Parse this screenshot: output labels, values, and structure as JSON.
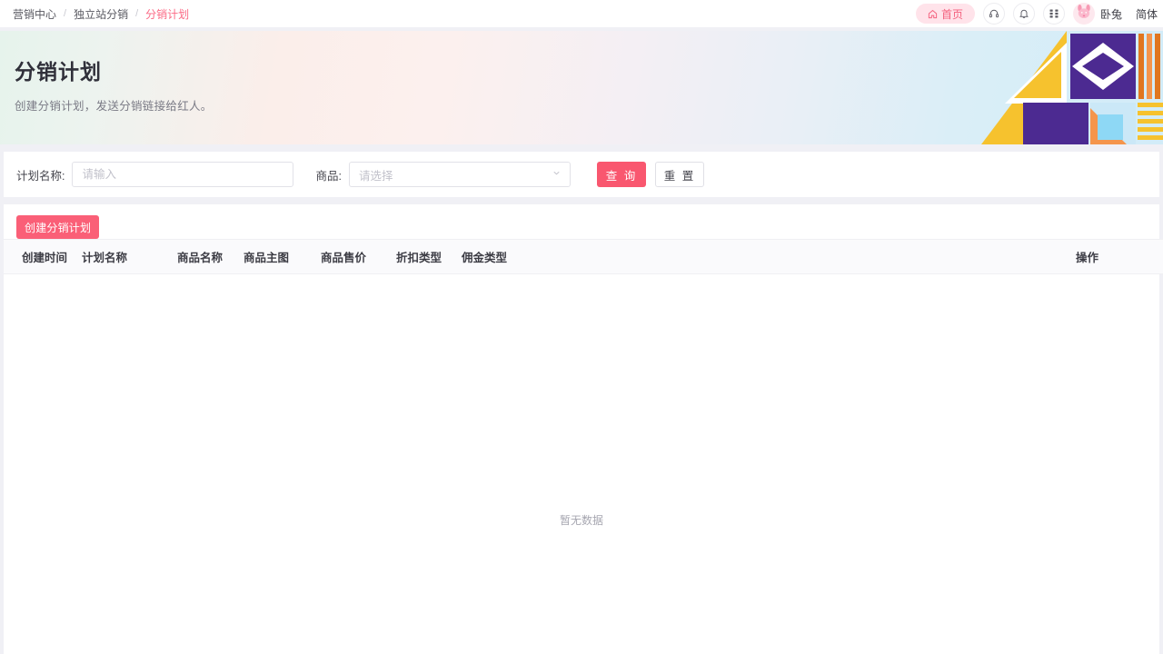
{
  "breadcrumb": {
    "items": [
      {
        "label": "营销中心",
        "active": false
      },
      {
        "label": "独立站分销",
        "active": false
      },
      {
        "label": "分销计划",
        "active": true
      }
    ],
    "separator": "/"
  },
  "topbar": {
    "home_label": "首页",
    "home_icon": "home-icon",
    "service_icon": "headset-icon",
    "notification_icon": "bell-icon",
    "apps_icon": "grid-apps-icon",
    "avatar_icon": "rabbit-avatar-icon",
    "username": "卧兔",
    "language": "简体"
  },
  "banner": {
    "title": "分销计划",
    "subtitle": "创建分销计划，发送分销链接给红人。",
    "colors": {
      "purple": "#4c2a91",
      "yellow": "#f6c22e",
      "orange": "#f5954b",
      "orange_dark": "#e0761f",
      "light_blue": "#8ed8f5",
      "pale_blue": "#cbe8f7",
      "white": "#ffffff"
    }
  },
  "filters": {
    "plan_name": {
      "label": "计划名称:",
      "placeholder": "请输入",
      "value": ""
    },
    "product": {
      "label": "商品:",
      "placeholder": "请选择",
      "value": "",
      "arrow_icon": "chevron-down-icon"
    },
    "search_button": "查 询",
    "reset_button": "重 置"
  },
  "toolbar": {
    "create_button": "创建分销计划"
  },
  "table": {
    "columns": [
      "创建时间",
      "计划名称",
      "商品名称",
      "商品主图",
      "商品售价",
      "折扣类型",
      "佣金类型",
      "操作"
    ],
    "rows": [],
    "empty_text": "暂无数据"
  },
  "theme": {
    "accent_pink": "#f9576f",
    "accent_pink_soft": "#ffe3ea",
    "link_pink": "#fb6a85",
    "page_bg": "#f0f0f5"
  }
}
